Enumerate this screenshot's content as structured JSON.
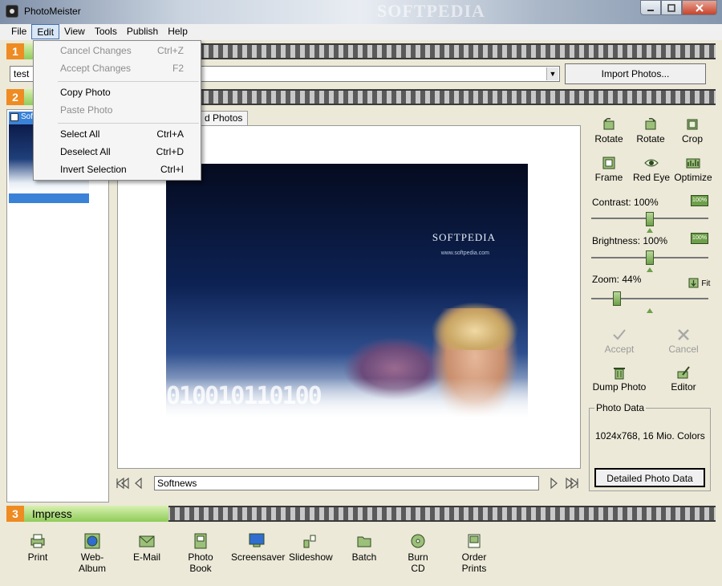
{
  "window": {
    "title": "PhotoMeister",
    "watermark": "SOFTPEDIA"
  },
  "menubar": {
    "items": [
      "File",
      "Edit",
      "View",
      "Tools",
      "Publish",
      "Help"
    ]
  },
  "edit_menu": {
    "items": [
      {
        "label": "Cancel Changes",
        "shortcut": "Ctrl+Z",
        "enabled": false
      },
      {
        "label": "Accept Changes",
        "shortcut": "F2",
        "enabled": false
      },
      {
        "label": "Copy Photo",
        "shortcut": "",
        "enabled": true
      },
      {
        "label": "Paste Photo",
        "shortcut": "",
        "enabled": false
      },
      {
        "label": "Select All",
        "shortcut": "Ctrl+A",
        "enabled": true
      },
      {
        "label": "Deselect All",
        "shortcut": "Ctrl+D",
        "enabled": true
      },
      {
        "label": "Invert Selection",
        "shortcut": "Ctrl+I",
        "enabled": true
      }
    ]
  },
  "sections": {
    "s1": {
      "num": "1"
    },
    "s2": {
      "num": "2"
    },
    "s3": {
      "num": "3",
      "label": "Impress"
    }
  },
  "import": {
    "folder_value": "test",
    "button": "Import Photos..."
  },
  "thumbnails": [
    {
      "label": "Sof",
      "checked": false
    }
  ],
  "preview": {
    "tab_label": "d Photos",
    "caption": "Softnews",
    "photo_logo": "SOFTPEDIA",
    "photo_url": "www.softpedia.com",
    "digits": "010010110100"
  },
  "tools": {
    "row1": [
      "Rotate",
      "Rotate",
      "Crop"
    ],
    "row2": [
      "Frame",
      "Red Eye",
      "Optimize"
    ],
    "contrast": "Contrast: 100%",
    "brightness": "Brightness: 100%",
    "zoom": "Zoom: 44%",
    "pct_button": "100%",
    "fit": "Fit",
    "accept": "Accept",
    "cancel": "Cancel",
    "dump": "Dump Photo",
    "editor": "Editor"
  },
  "sliders": {
    "contrast": 0.5,
    "brightness": 0.5,
    "zoom": 0.2
  },
  "photo_data": {
    "legend": "Photo Data",
    "info": "1024x768, 16 Mio. Colors",
    "button": "Detailed Photo Data"
  },
  "impress": {
    "buttons": [
      "Print",
      "Web-Album",
      "E-Mail",
      "Photo Book",
      "Screensaver",
      "Slideshow",
      "Batch",
      "Burn CD",
      "Order Prints"
    ]
  },
  "colors": {
    "section_orange": "#ee8b22",
    "section_green": "#8fcc5a",
    "slider_green": "#6ea04a"
  }
}
